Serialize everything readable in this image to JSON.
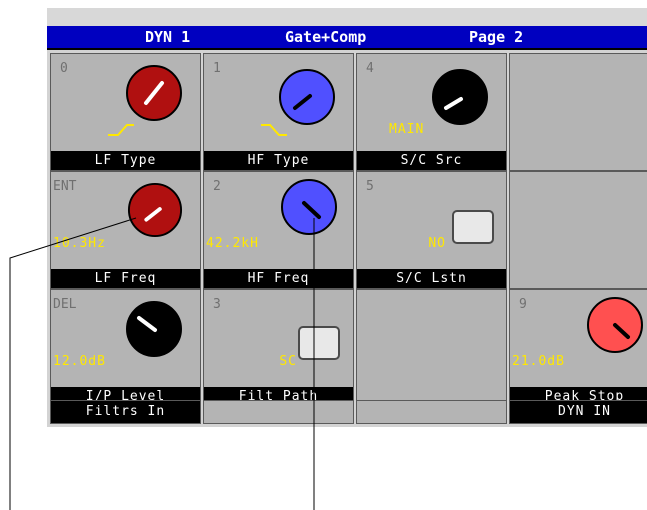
{
  "colors": {
    "title_bar": "#0000c0",
    "panel": "#b4b4b4",
    "value_text": "#ffe800",
    "knob_red": "#b01010",
    "knob_blue": "#5050ff",
    "knob_black": "#000000",
    "knob_pink": "#ff5050"
  },
  "title": {
    "section": "DYN 1",
    "mode": "Gate+Comp",
    "page": "Page 2"
  },
  "controls": {
    "lf_type": {
      "index": "0",
      "label": "LF Type",
      "icon": "low-shelf-icon"
    },
    "hf_type": {
      "index": "1",
      "label": "HF Type",
      "icon": "high-shelf-icon"
    },
    "sc_src": {
      "index": "4",
      "label": "S/C Src",
      "value": "MAIN"
    },
    "lf_freq": {
      "index": "ENT",
      "label": "LF Freq",
      "value": "10.3Hz"
    },
    "hf_freq": {
      "index": "2",
      "label": "HF Freq",
      "value": "42.2kH"
    },
    "sc_lstn": {
      "index": "5",
      "label": "S/C Lstn",
      "value": "NO"
    },
    "ip_level": {
      "index": "DEL",
      "label": "I/P Level",
      "value": "12.0dB"
    },
    "filt_path": {
      "index": "3",
      "label": "Filt Path",
      "value": "SC"
    },
    "peak_stop": {
      "index": "9",
      "label": "Peak Stop",
      "value": "21.0dB"
    }
  },
  "bottom_buttons": {
    "filters_in": "Filtrs In",
    "dyn_in": "DYN IN"
  }
}
